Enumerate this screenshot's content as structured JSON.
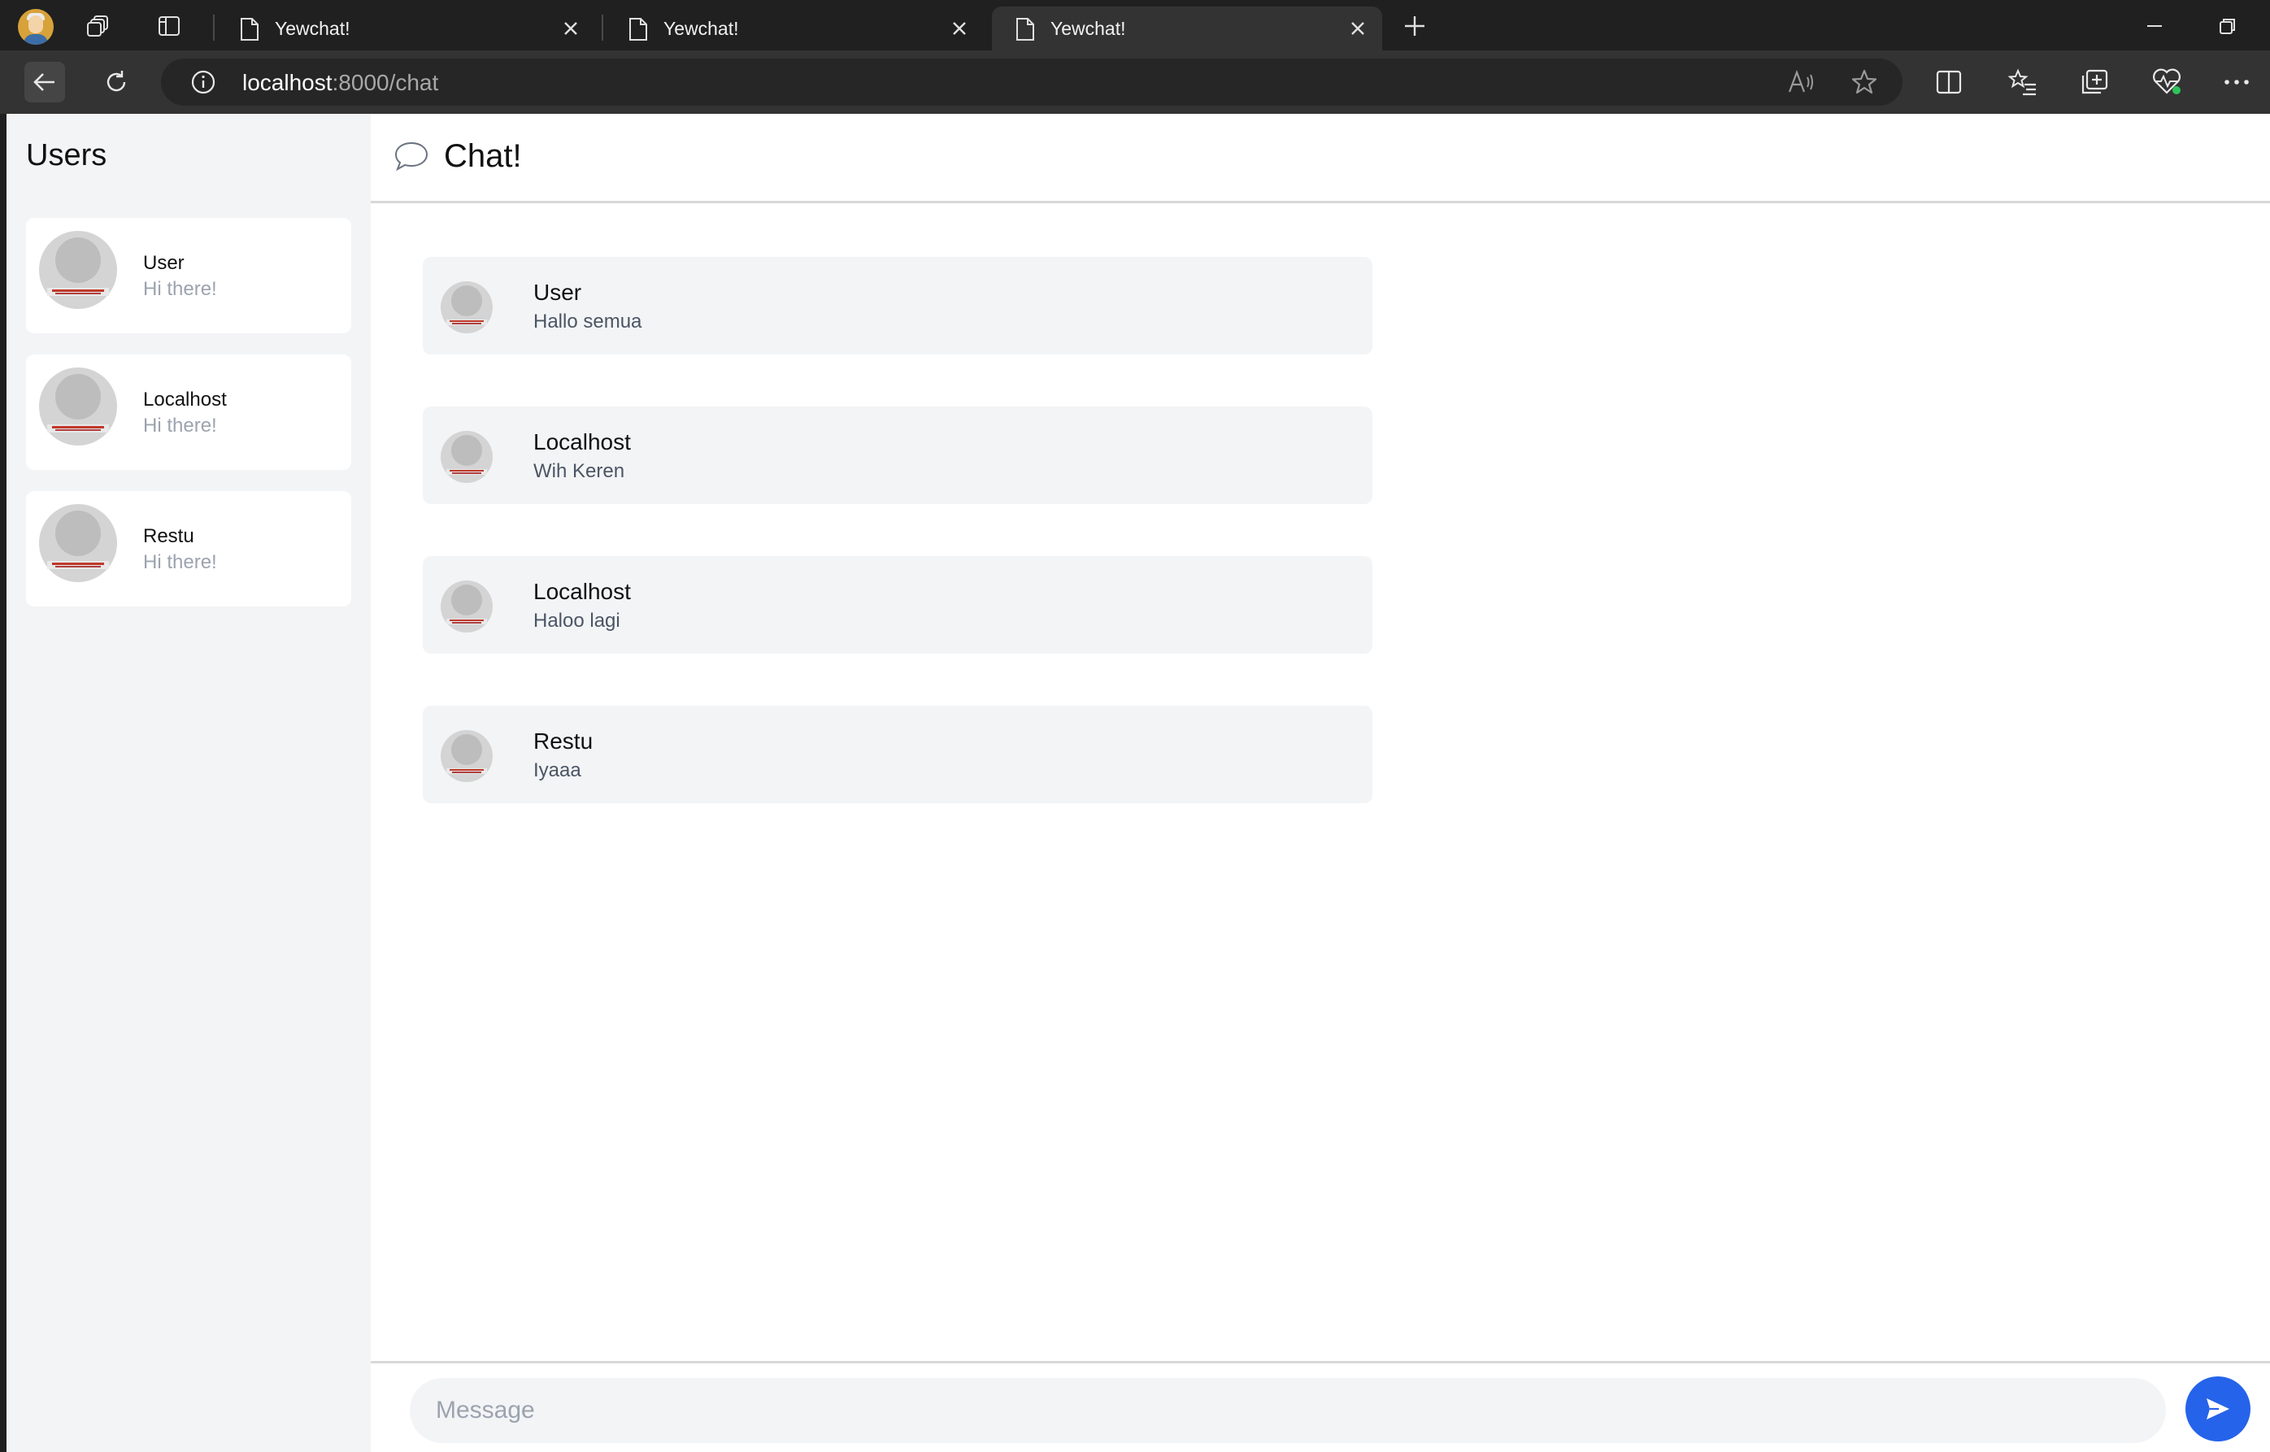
{
  "browser": {
    "tabs": [
      {
        "title": "Yewchat!",
        "active": false
      },
      {
        "title": "Yewchat!",
        "active": false
      },
      {
        "title": "Yewchat!",
        "active": true
      }
    ],
    "url_host": "localhost",
    "url_path": ":8000/chat"
  },
  "sidebar": {
    "heading": "Users",
    "users": [
      {
        "name": "User",
        "preview": "Hi there!"
      },
      {
        "name": "Localhost",
        "preview": "Hi there!"
      },
      {
        "name": "Restu",
        "preview": "Hi there!"
      }
    ]
  },
  "chat": {
    "title": "Chat!",
    "messages": [
      {
        "name": "User",
        "text": "Hallo semua"
      },
      {
        "name": "Localhost",
        "text": "Wih Keren"
      },
      {
        "name": "Localhost",
        "text": "Haloo lagi"
      },
      {
        "name": "Restu",
        "text": "Iyaaa"
      }
    ],
    "composer_placeholder": "Message"
  },
  "colors": {
    "accent": "#2563eb",
    "sidebar_bg": "#f3f4f6",
    "browser_chrome": "#202020"
  }
}
